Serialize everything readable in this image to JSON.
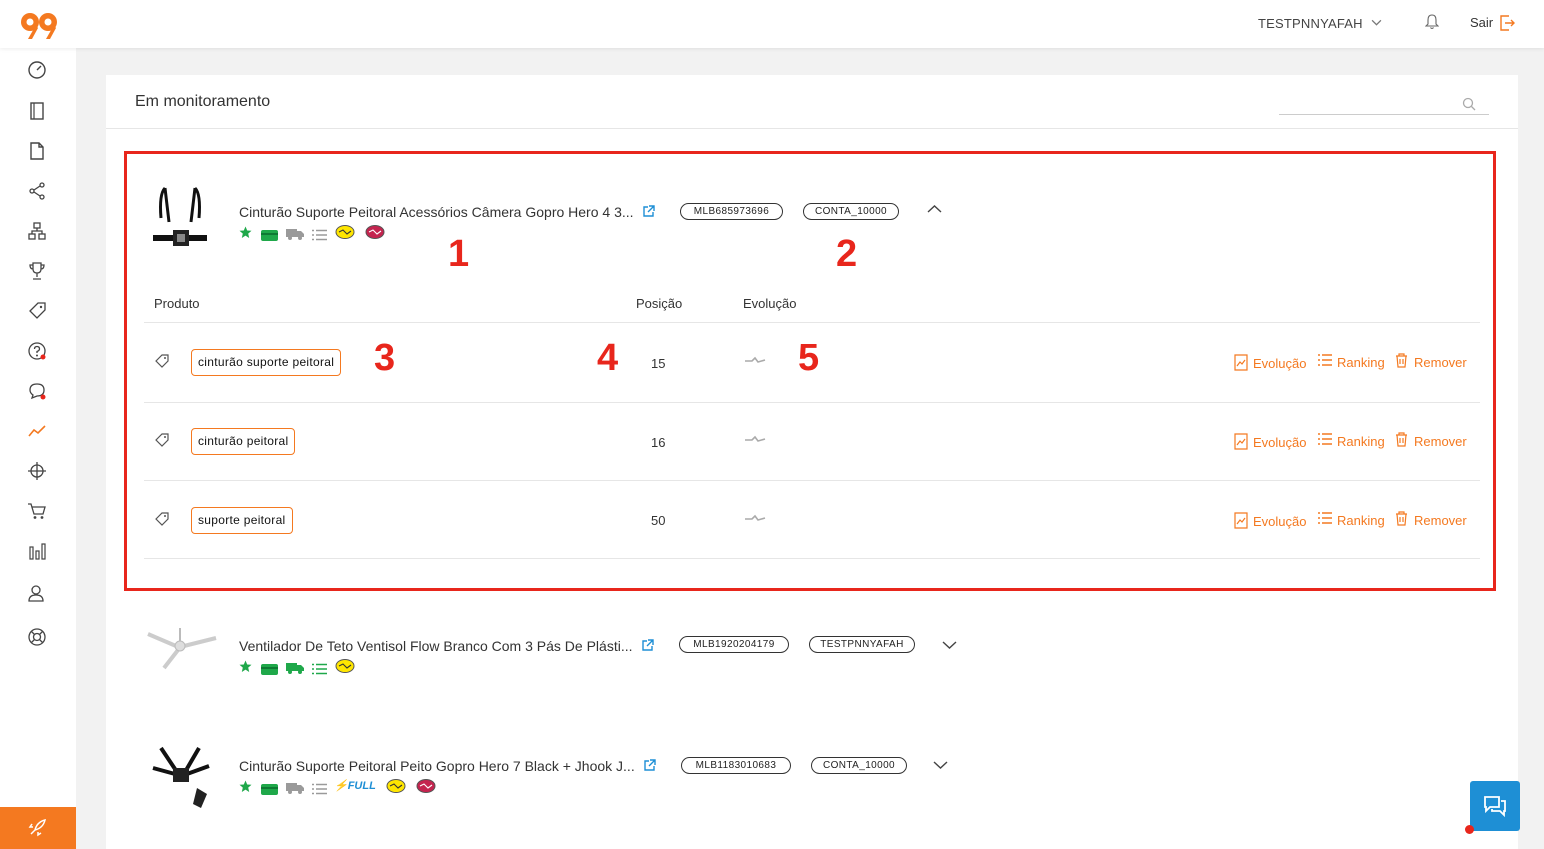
{
  "header": {
    "user": "TESTPNNYAFAH",
    "logout": "Sair"
  },
  "sidebar": {
    "items": [
      "dashboard-icon",
      "notebook-icon",
      "document-icon",
      "share-icon",
      "structure-icon",
      "trophy-icon",
      "price-tag-icon",
      "question-icon",
      "chat-icon",
      "trend-icon",
      "target-icon",
      "cart-icon",
      "bar-chart-icon",
      "users-icon",
      "support-icon"
    ],
    "footer": "rocket-icon"
  },
  "panel": {
    "title": "Em monitoramento",
    "search_placeholder": ""
  },
  "products": [
    {
      "title": "Cinturão Suporte Peitoral Acessórios Câmera Gopro Hero 4 3...",
      "mlb": "MLB685973696",
      "account": "CONTA_10000",
      "expanded": true,
      "columns": {
        "produto": "Produto",
        "posicao": "Posição",
        "evolucao": "Evolução"
      },
      "keywords": [
        {
          "term": "cinturão suporte peitoral",
          "position": "15"
        },
        {
          "term": "cinturão peitoral",
          "position": "16"
        },
        {
          "term": "suporte peitoral",
          "position": "50"
        }
      ]
    },
    {
      "title": "Ventilador De Teto Ventisol Flow Branco Com 3 Pás De Plásti...",
      "mlb": "MLB1920204179",
      "account": "TESTPNNYAFAH",
      "expanded": false
    },
    {
      "title": "Cinturão Suporte Peitoral Peito Gopro Hero 7 Black + Jhook J...",
      "mlb": "MLB1183010683",
      "account": "CONTA_10000",
      "expanded": false,
      "full_label": "FULL"
    }
  ],
  "actions": {
    "evolucao": "Evolução",
    "ranking": "Ranking",
    "remover": "Remover"
  },
  "annotations": [
    "1",
    "2",
    "3",
    "4",
    "5"
  ],
  "colors": {
    "accent": "#f47920",
    "annotation": "#e8261c",
    "green": "#1fa84a",
    "gray_icon": "#9a9a9a",
    "chat": "#1e8fd5"
  }
}
